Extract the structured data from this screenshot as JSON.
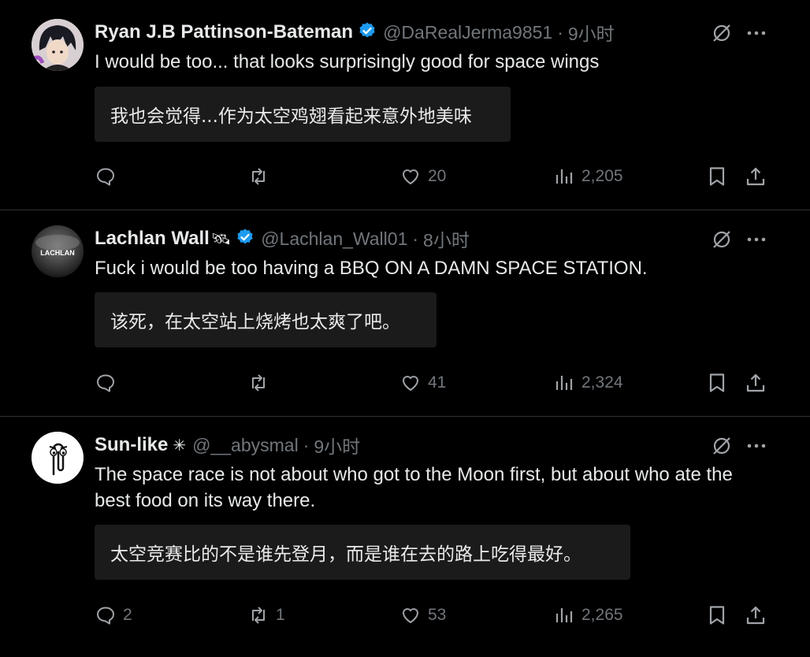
{
  "tweets": [
    {
      "name": "Ryan J.B Pattinson-Bateman",
      "handle": "@DaRealJerma9851",
      "sep": "·",
      "time": "9小时",
      "text": "I would be too... that looks surprisingly good for space wings",
      "translation": "我也会觉得...作为太空鸡翅看起来意外地美味",
      "replies": "",
      "retweets": "",
      "likes": "20",
      "views": "2,205",
      "verified": true
    },
    {
      "name": "Lachlan Wall",
      "name_emoji": "🛰",
      "handle": "@Lachlan_Wall01",
      "sep": "·",
      "time": "8小时",
      "text": "Fuck i would be too having a BBQ ON A DAMN SPACE STATION.",
      "translation": "该死，在太空站上烧烤也太爽了吧。",
      "avatar_text": "LACHLAN",
      "replies": "",
      "retweets": "",
      "likes": "41",
      "views": "2,324",
      "verified": true
    },
    {
      "name": "Sun-like",
      "name_symbol": "✳",
      "handle": "@__abysmal",
      "sep": "·",
      "time": "9小时",
      "text": "The space race is not about who got to the Moon first, but about who ate the best food on its way there.",
      "translation": "太空竞赛比的不是谁先登月，而是谁在去的路上吃得最好。",
      "replies": "2",
      "retweets": "1",
      "likes": "53",
      "views": "2,265",
      "verified": false
    }
  ],
  "colors": {
    "background": "#000000",
    "text": "#e7e9ea",
    "muted": "#71767b",
    "verified": "#1d9bf0",
    "translation_bg": "#1b1b1b"
  },
  "icons": [
    "reply-icon",
    "retweet-icon",
    "like-icon",
    "views-icon",
    "bookmark-icon",
    "share-icon",
    "grok-icon",
    "more-icon",
    "verified-badge-icon"
  ]
}
